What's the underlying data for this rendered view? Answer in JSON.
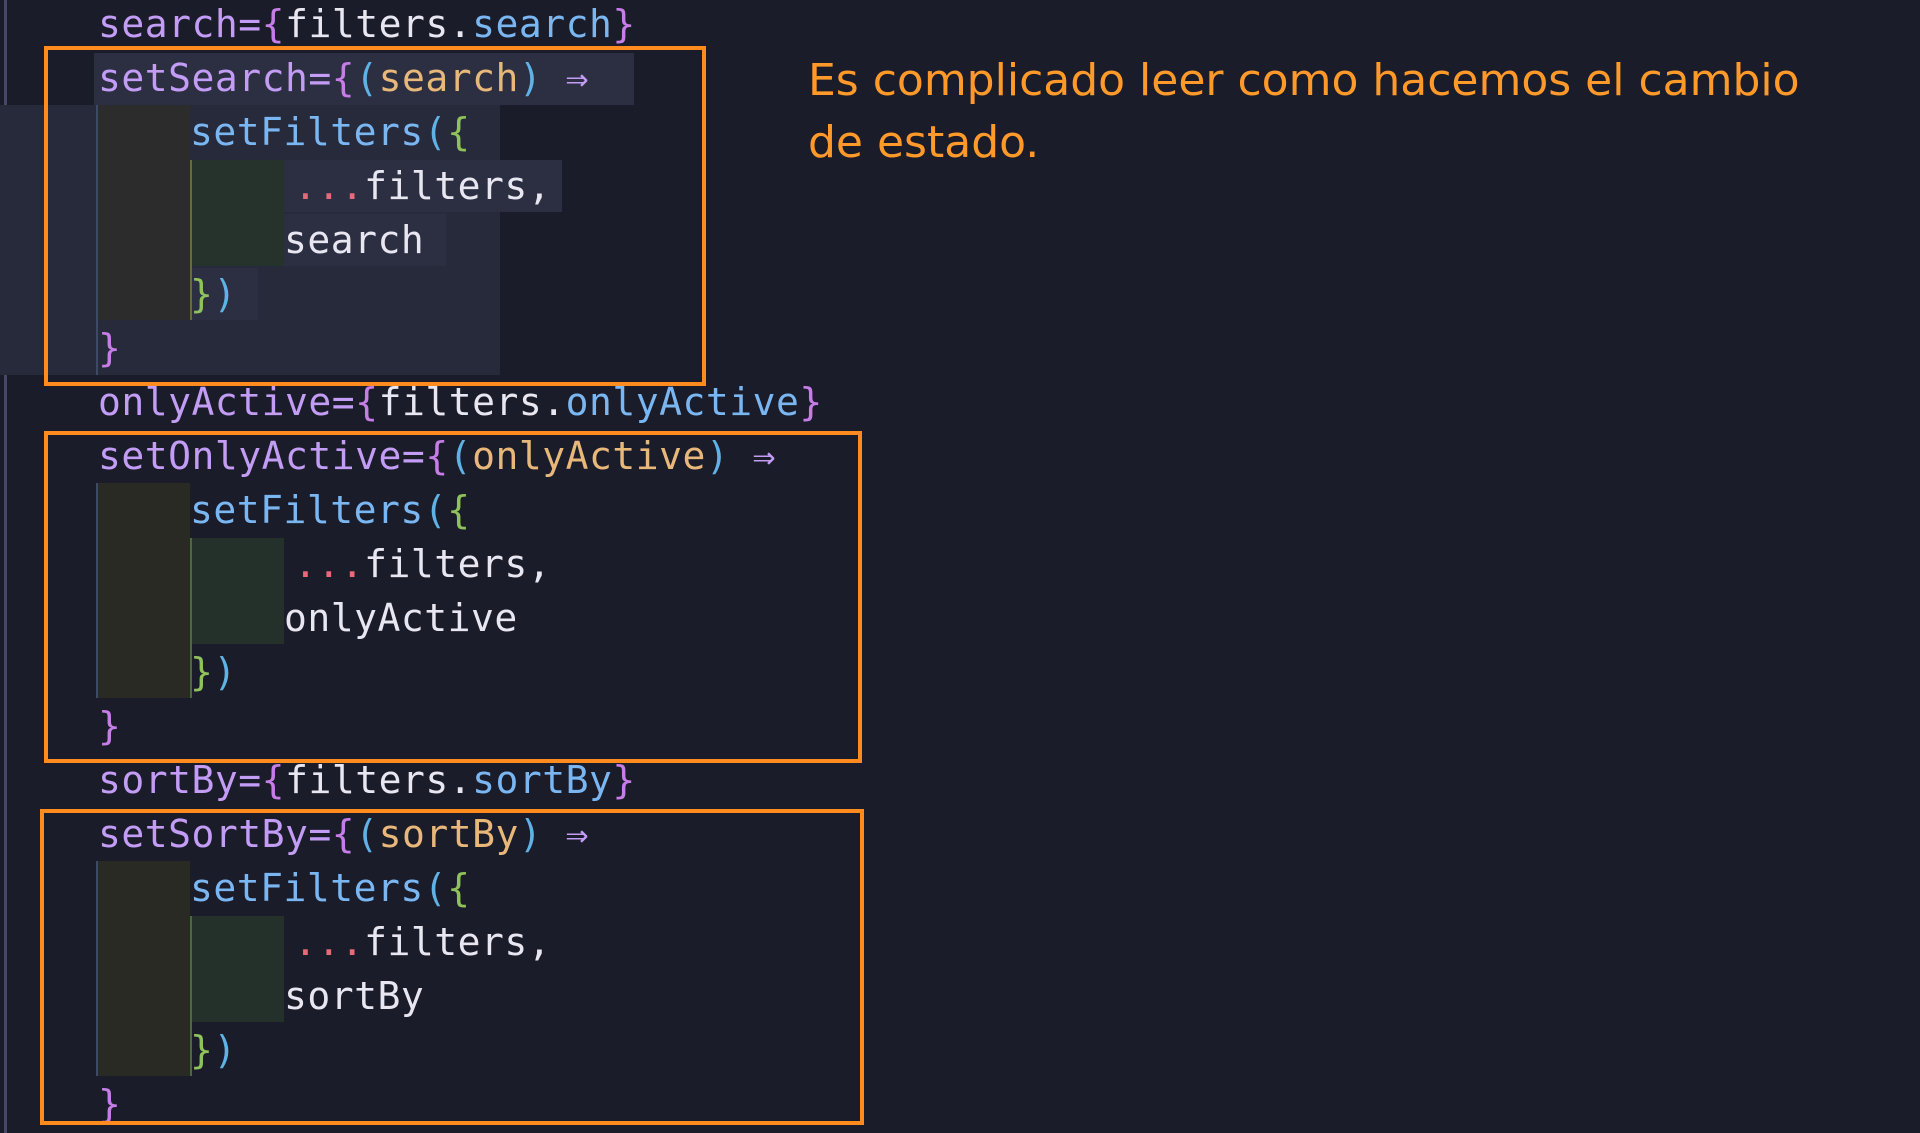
{
  "annotation": {
    "text": "Es complicado leer como hacemos el cambio de estado."
  },
  "colors": {
    "background": "#1b1c29",
    "annotation_box": "#ff8a1e",
    "annotation_text": "#ff9a2a"
  },
  "code": {
    "line1": {
      "attr": "search",
      "eq": "=",
      "open": "{",
      "obj": "filters",
      "dot": ".",
      "prop": "search",
      "close": "}"
    },
    "line2": {
      "attr": "setSearch",
      "eq": "=",
      "open": "{",
      "popen": "(",
      "param": "search",
      "pclose": ")",
      "arrow": " ⇒"
    },
    "line3": {
      "fn": "setFilters",
      "open": "(",
      "brace": "{"
    },
    "line4": {
      "spread": "...",
      "obj": "filters",
      "comma": ","
    },
    "line5": {
      "text": "search"
    },
    "line6": {
      "brace": "}",
      "close": ")"
    },
    "line7": {
      "brace": "}"
    },
    "line8": {
      "attr": "onlyActive",
      "eq": "=",
      "open": "{",
      "obj": "filters",
      "dot": ".",
      "prop": "onlyActive",
      "close": "}"
    },
    "line9": {
      "attr": "setOnlyActive",
      "eq": "=",
      "open": "{",
      "popen": "(",
      "param": "onlyActive",
      "pclose": ")",
      "arrow": " ⇒"
    },
    "line10": {
      "fn": "setFilters",
      "open": "(",
      "brace": "{"
    },
    "line11": {
      "spread": "...",
      "obj": "filters",
      "comma": ","
    },
    "line12": {
      "text": "onlyActive"
    },
    "line13": {
      "brace": "}",
      "close": ")"
    },
    "line14": {
      "brace": "}"
    },
    "line15": {
      "attr": "sortBy",
      "eq": "=",
      "open": "{",
      "obj": "filters",
      "dot": ".",
      "prop": "sortBy",
      "close": "}"
    },
    "line16": {
      "attr": "setSortBy",
      "eq": "=",
      "open": "{",
      "popen": "(",
      "param": "sortBy",
      "pclose": ")",
      "arrow": " ⇒"
    },
    "line17": {
      "fn": "setFilters",
      "open": "(",
      "brace": "{"
    },
    "line18": {
      "spread": "...",
      "obj": "filters",
      "comma": ","
    },
    "line19": {
      "text": "sortBy"
    },
    "line20": {
      "brace": "}",
      "close": ")"
    },
    "line21": {
      "brace": "}"
    }
  }
}
